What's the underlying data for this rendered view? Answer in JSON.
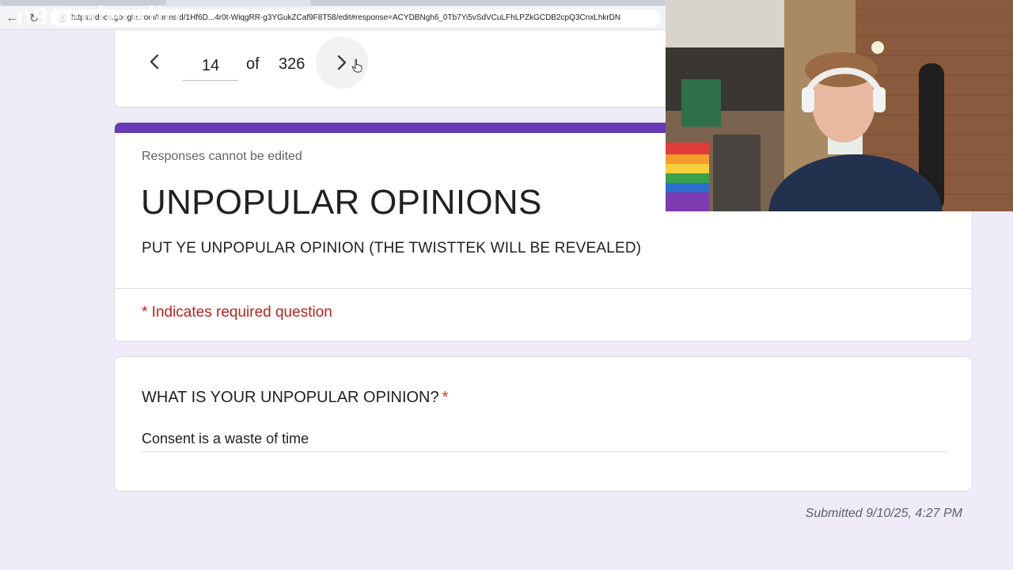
{
  "browser": {
    "url": "https://docs.google.com/forms/d/1Hf6D...4r0t-WiqgRR-g3YGukZCaf9F8T58/edit#response=ACYDBNgh6_0Tb7Yi5vSdVCuLFhLPZkGCDB2cpQ3CnxLhkrDN"
  },
  "watermark": "n9#enieudio",
  "response_nav": {
    "current_page": "14",
    "of_label": "of",
    "total": "326"
  },
  "form": {
    "notice": "Responses cannot be edited",
    "title": "UNPOPULAR OPINIONS",
    "description": "PUT YE UNPOPULAR OPINION (THE TWISTTEK WILL BE REVEALED)",
    "required_note": "* Indicates required question",
    "accent_color": "#673ab7"
  },
  "question": {
    "title": "WHAT IS YOUR UNPOPULAR OPINION?",
    "required_marker": "*",
    "answer": "Consent is a waste of time"
  },
  "submitted": "Submitted 9/10/25, 4:27 PM"
}
